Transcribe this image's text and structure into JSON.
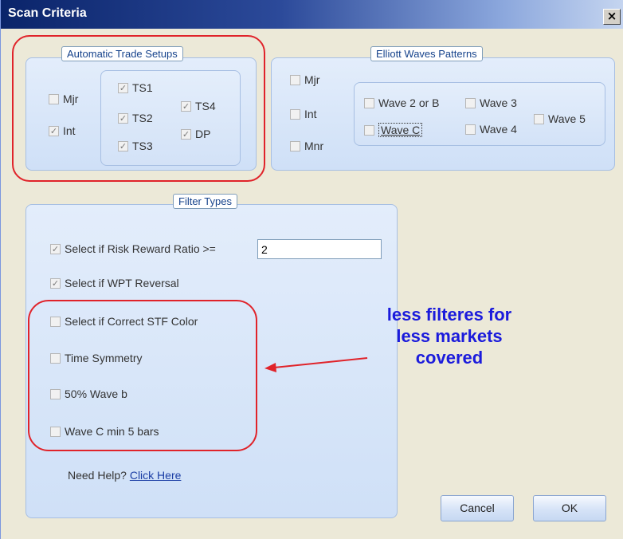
{
  "window": {
    "title": "Scan Criteria",
    "close_glyph": "×"
  },
  "auto_trade": {
    "legend": "Automatic Trade Setups",
    "degree": [
      {
        "label": "Mjr",
        "checked": false
      },
      {
        "label": "Int",
        "checked": true
      }
    ],
    "setups": [
      {
        "label": "TS1",
        "checked": true
      },
      {
        "label": "TS2",
        "checked": true
      },
      {
        "label": "TS3",
        "checked": true
      },
      {
        "label": "TS4",
        "checked": true
      },
      {
        "label": "DP",
        "checked": true
      }
    ]
  },
  "elliott": {
    "legend": "Elliott Waves Patterns",
    "degree": [
      {
        "label": "Mjr",
        "checked": false
      },
      {
        "label": "Int",
        "checked": false
      },
      {
        "label": "Mnr",
        "checked": false
      }
    ],
    "waves": [
      {
        "label": "Wave 2 or B",
        "checked": false
      },
      {
        "label": "Wave 3",
        "checked": false
      },
      {
        "label": "Wave 5",
        "checked": false
      },
      {
        "label": "Wave C",
        "checked": false
      },
      {
        "label": "Wave 4",
        "checked": false
      }
    ]
  },
  "filters": {
    "legend": "Filter Types",
    "items": [
      {
        "label": "Select if Risk Reward Ratio >=",
        "checked": true
      },
      {
        "label": "Select if WPT Reversal",
        "checked": true
      },
      {
        "label": "Select if Correct STF Color",
        "checked": false
      },
      {
        "label": "Time Symmetry",
        "checked": false
      },
      {
        "label": "50% Wave b",
        "checked": false
      },
      {
        "label": "Wave C min 5 bars",
        "checked": false
      }
    ],
    "risk_reward_value": "2"
  },
  "help": {
    "prefix": "Need Help?",
    "link": "Click Here"
  },
  "buttons": {
    "cancel": "Cancel",
    "ok": "OK"
  },
  "annotation": {
    "lines": [
      "less filteres for",
      "less markets",
      "covered"
    ],
    "color": "#1b1bdc",
    "highlight_color": "#e0232a"
  },
  "icons": {
    "check": "check-icon",
    "arrow": "red-arrow-icon",
    "close": "close-icon"
  }
}
